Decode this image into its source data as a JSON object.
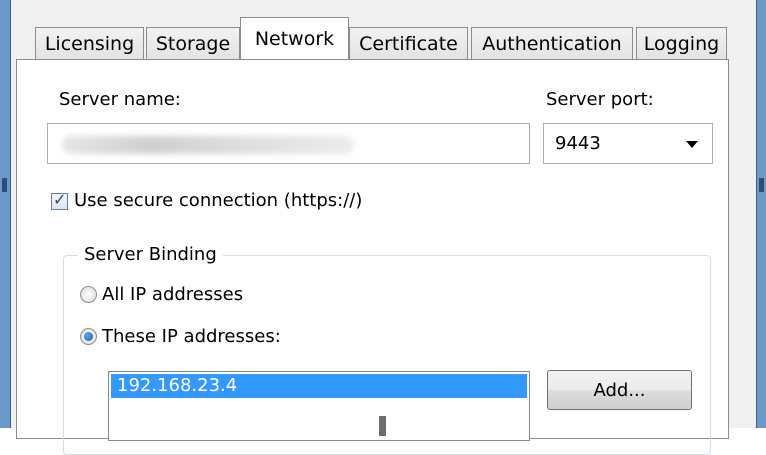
{
  "tabs": [
    {
      "label": "Licensing"
    },
    {
      "label": "Storage"
    },
    {
      "label": "Network"
    },
    {
      "label": "Certificate"
    },
    {
      "label": "Authentication"
    },
    {
      "label": "Logging"
    }
  ],
  "active_tab": "Network",
  "network": {
    "server_name_label": "Server name:",
    "server_name_value": "",
    "server_port_label": "Server port:",
    "server_port_value": "9443",
    "secure_checkbox_label": "Use secure connection (https://)",
    "secure_checked": true,
    "binding": {
      "title": "Server Binding",
      "option_all": "All IP addresses",
      "option_these": "These IP addresses:",
      "selected": "These IP addresses:",
      "ip_list": [
        "192.168.23.4"
      ],
      "add_button": "Add..."
    }
  },
  "colors": {
    "selection": "#3399ff",
    "window_frame": "#6b9ac8",
    "panel_bg": "#ffffff"
  }
}
